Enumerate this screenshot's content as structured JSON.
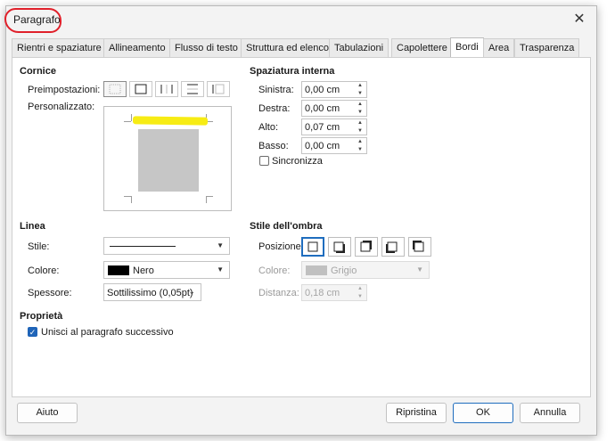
{
  "dialog": {
    "title": "Paragrafo"
  },
  "tabs": [
    "Rientri e spaziature",
    "Allineamento",
    "Flusso di testo",
    "Struttura ed elenco",
    "Tabulazioni",
    "Capolettere",
    "Bordi",
    "Area",
    "Trasparenza"
  ],
  "cornice": {
    "title": "Cornice",
    "preimpostazioni_label": "Preimpostazioni:",
    "personalizzato_label": "Personalizzato:"
  },
  "spaziatura": {
    "title": "Spaziatura interna",
    "sinistra_label": "Sinistra:",
    "sinistra_value": "0,00 cm",
    "destra_label": "Destra:",
    "destra_value": "0,00 cm",
    "alto_label": "Alto:",
    "alto_value": "0,07 cm",
    "basso_label": "Basso:",
    "basso_value": "0,00 cm",
    "sincronizza_label": "Sincronizza"
  },
  "linea": {
    "title": "Linea",
    "stile_label": "Stile:",
    "colore_label": "Colore:",
    "colore_value": "Nero",
    "colore_swatch": "#000000",
    "spessore_label": "Spessore:",
    "spessore_value": "Sottilissimo (0,05pt)"
  },
  "ombra": {
    "title": "Stile dell'ombra",
    "posizione_label": "Posizione:",
    "colore_label": "Colore:",
    "colore_value": "Grigio",
    "colore_swatch": "#c0c0c0",
    "distanza_label": "Distanza:",
    "distanza_value": "0,18 cm"
  },
  "proprieta": {
    "title": "Proprietà",
    "unisci_label": "Unisci al paragrafo successivo"
  },
  "buttons": {
    "aiuto": "Aiuto",
    "ripristina": "Ripristina",
    "ok": "OK",
    "annulla": "Annulla"
  },
  "colors": {
    "accent": "#1f6dbe",
    "highlight": "#f7ec14",
    "title_circle": "#e0202a"
  }
}
